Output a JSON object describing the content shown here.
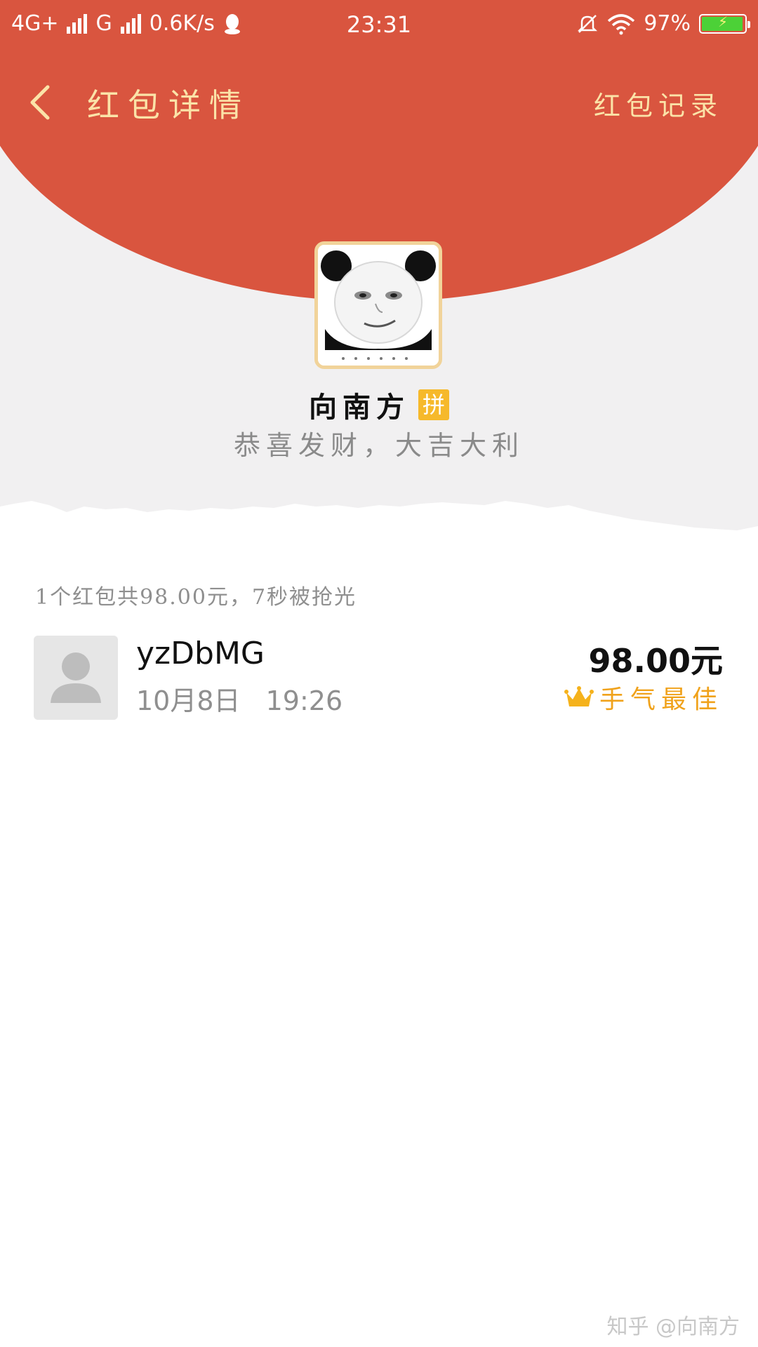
{
  "status_bar": {
    "network_1": "4G+",
    "network_2": "G",
    "speed": "0.6K/s",
    "time": "23:31",
    "battery_percent": "97%",
    "battery_level": 0.97
  },
  "header": {
    "title": "红包详情",
    "record_link": "红包记录"
  },
  "sender": {
    "name": "向南方",
    "badge": "拼",
    "greeting": "恭喜发财，大吉大利"
  },
  "summary": "1个红包共98.00元，7秒被抢光",
  "receivers": [
    {
      "name": "yzDbMG",
      "date": "10月8日",
      "time": "19:26",
      "amount": "98.00元",
      "tag": "手气最佳"
    }
  ],
  "watermark": "知乎 @向南方",
  "colors": {
    "header_red": "#d9553f",
    "gold_text": "#fbe3a8",
    "best_orange": "#f0a21b",
    "badge_yellow": "#f6b92b"
  }
}
